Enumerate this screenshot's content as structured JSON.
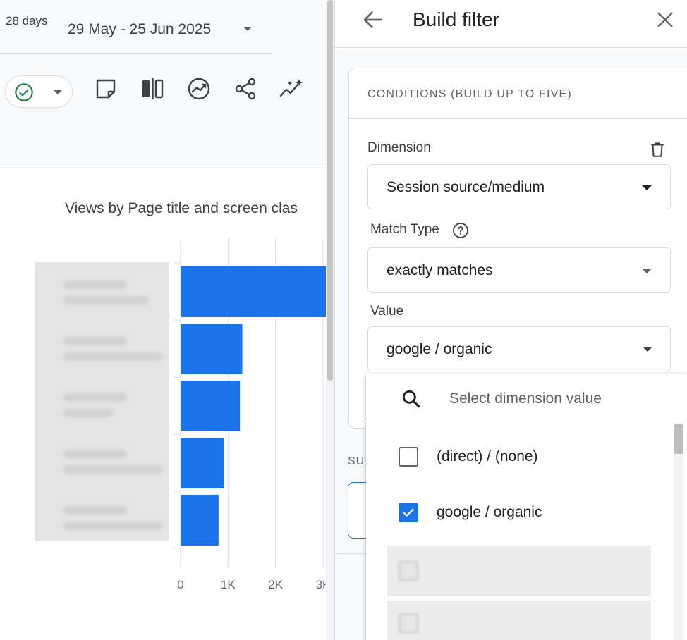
{
  "header": {
    "days_chip": "28 days",
    "date_range": "29 May - 25 Jun 2025"
  },
  "toolbar": {
    "icons": [
      "check-circle-icon",
      "note-icon",
      "compare-icon",
      "insights-icon",
      "share-icon",
      "sparkle-icon"
    ]
  },
  "chart_data": {
    "type": "bar",
    "orientation": "horizontal",
    "title": "Views by Page title and screen clas",
    "categories": [
      "",
      "",
      "",
      "",
      ""
    ],
    "values": [
      3200,
      1300,
      1250,
      920,
      800
    ],
    "x_ticks": [
      "0",
      "1K",
      "2K",
      "3K"
    ],
    "xlim": [
      0,
      3000
    ],
    "grid": true,
    "color": "#1a73e8"
  },
  "panel": {
    "title": "Build filter",
    "conditions_header": "CONDITIONS (BUILD UP TO FIVE)",
    "dimension": {
      "label": "Dimension",
      "value": "Session source/medium"
    },
    "match_type": {
      "label": "Match Type",
      "value": "exactly matches"
    },
    "value": {
      "label": "Value",
      "value": "google / organic"
    },
    "sub_label": "SU"
  },
  "dropdown": {
    "search_placeholder": "Select dimension value",
    "items": [
      {
        "label": "(direct) / (none)",
        "checked": false
      },
      {
        "label": "google / organic",
        "checked": true
      }
    ]
  },
  "colors": {
    "accent": "#1a73e8",
    "success": "#188038"
  }
}
